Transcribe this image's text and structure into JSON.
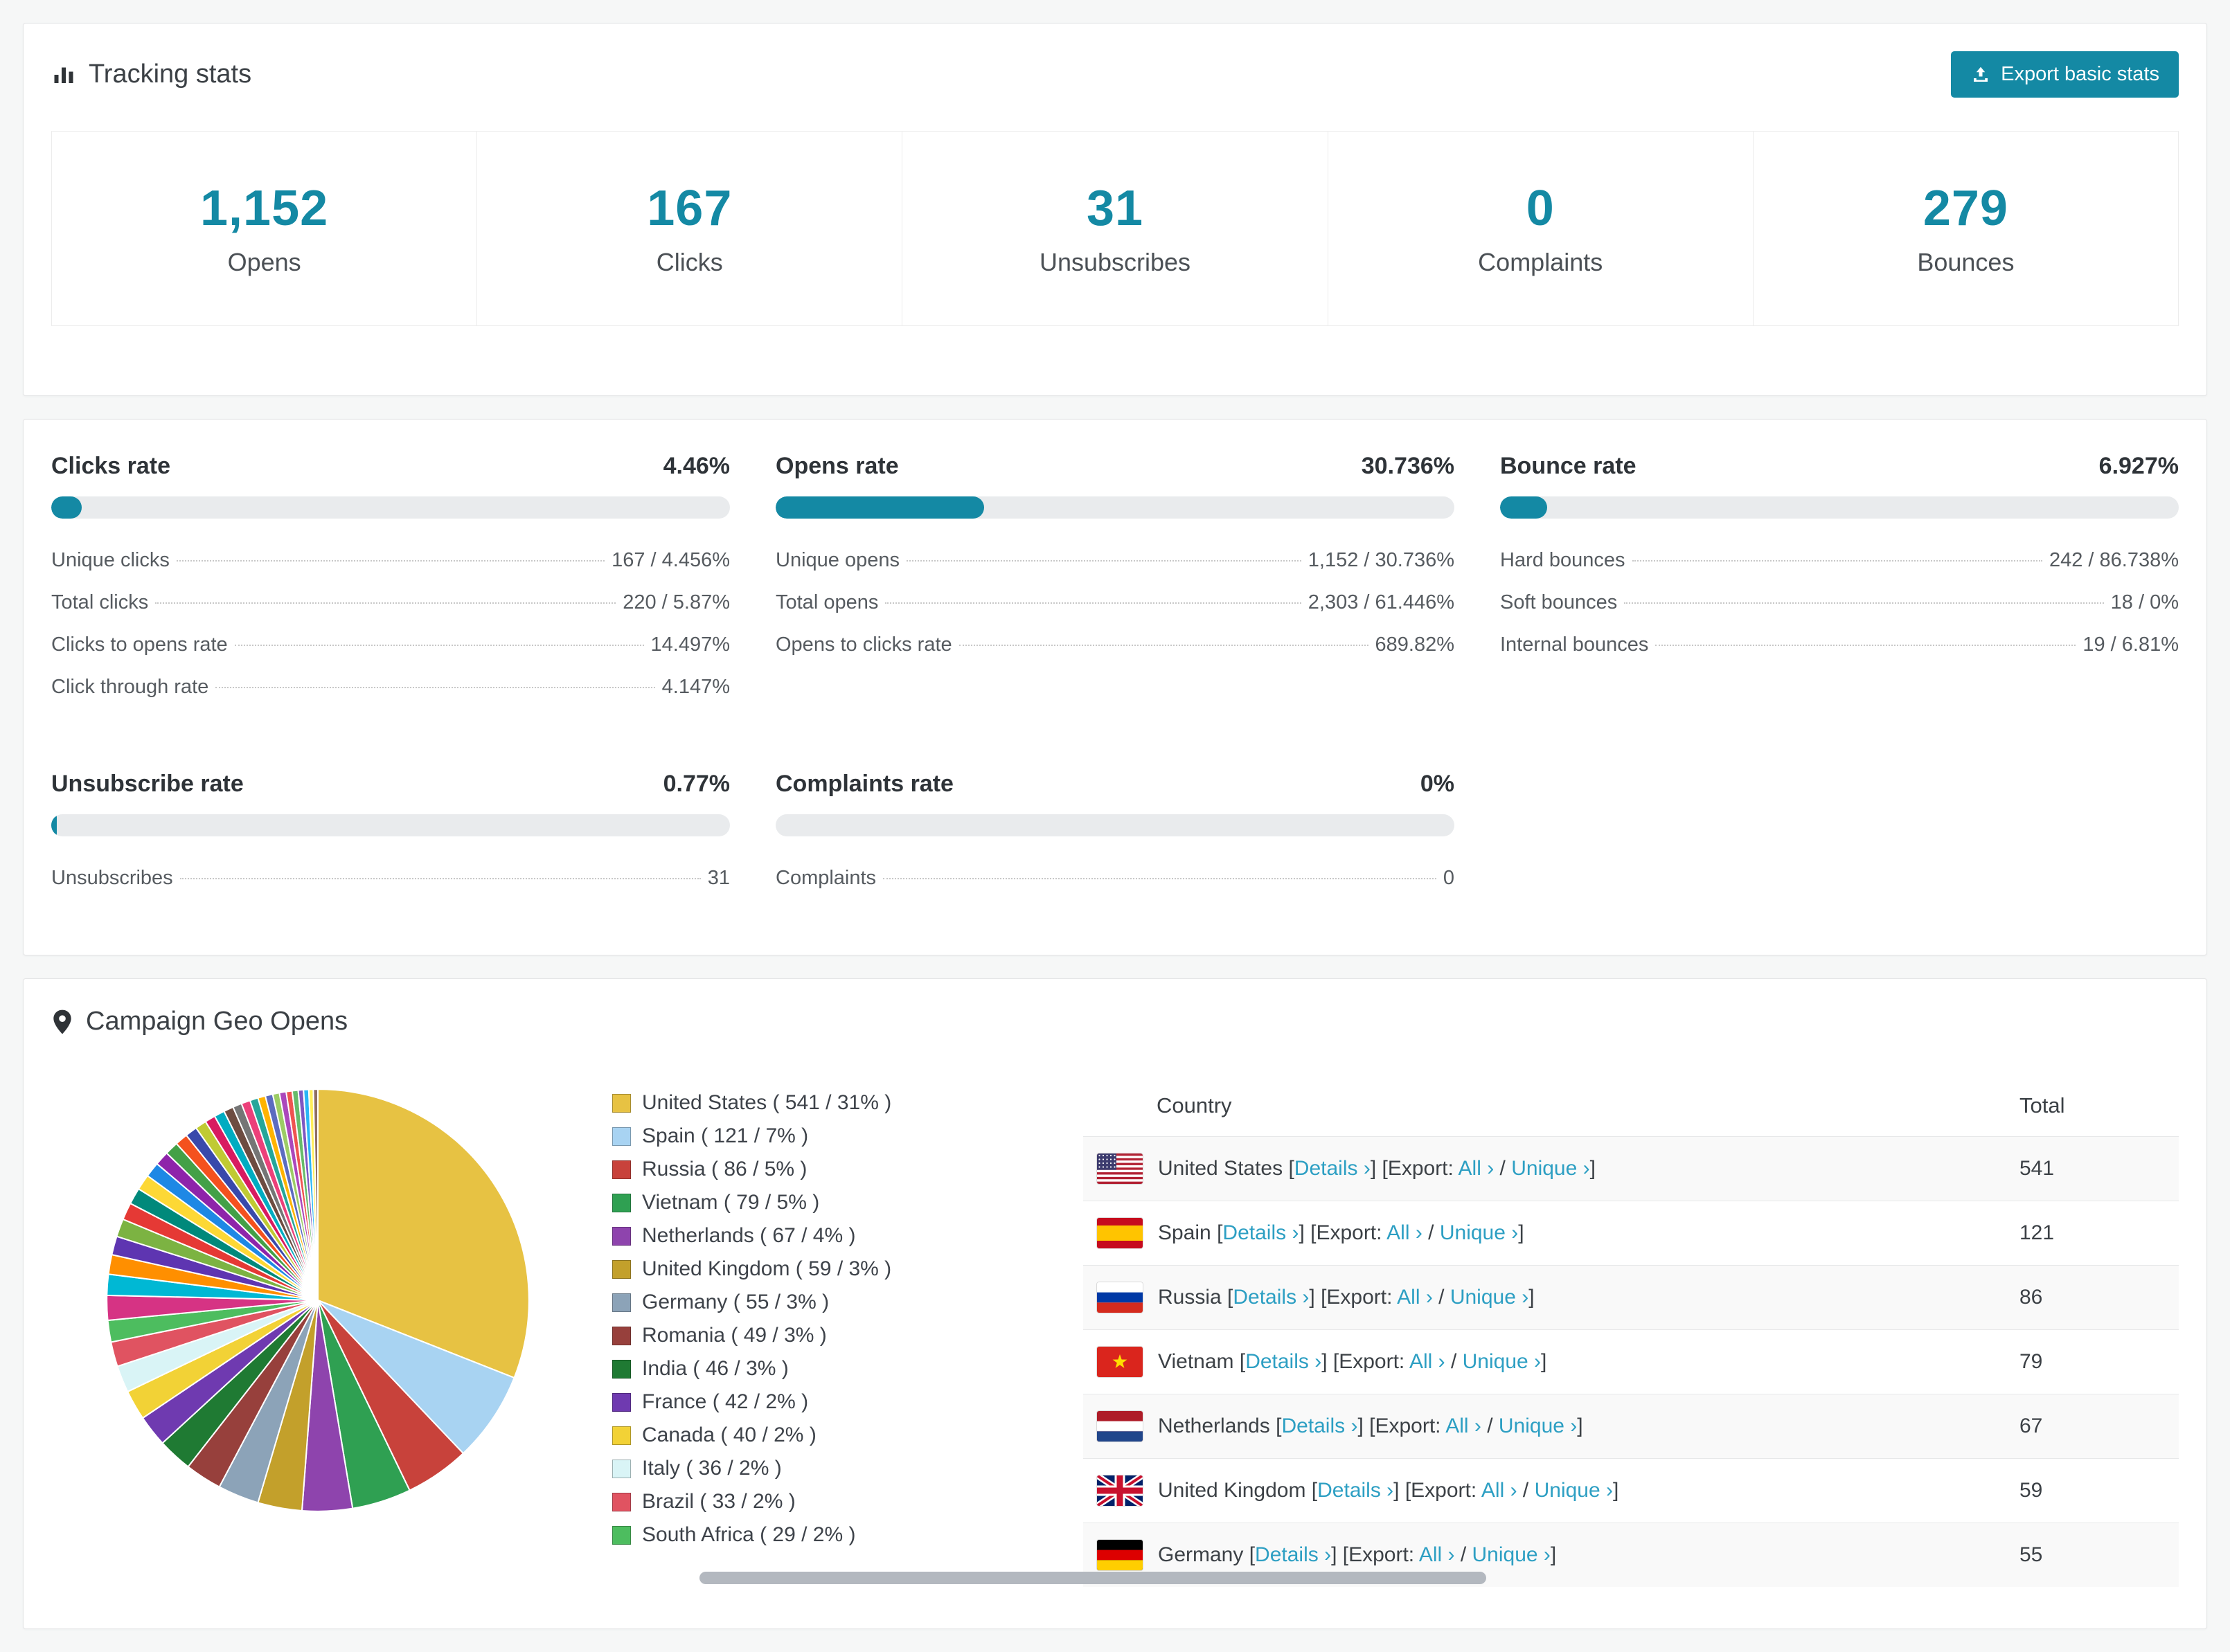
{
  "colors": {
    "accent": "#1489a4",
    "link": "#2d9fc3"
  },
  "tracking": {
    "title": "Tracking stats",
    "export_button": "Export basic stats",
    "stats": [
      {
        "value": "1,152",
        "label": "Opens"
      },
      {
        "value": "167",
        "label": "Clicks"
      },
      {
        "value": "31",
        "label": "Unsubscribes"
      },
      {
        "value": "0",
        "label": "Complaints"
      },
      {
        "value": "279",
        "label": "Bounces"
      }
    ]
  },
  "rates": [
    {
      "title": "Clicks rate",
      "value": "4.46%",
      "percent": 4.46,
      "rows": [
        {
          "label": "Unique clicks",
          "value": "167 / 4.456%"
        },
        {
          "label": "Total clicks",
          "value": "220 / 5.87%"
        },
        {
          "label": "Clicks to opens rate",
          "value": "14.497%"
        },
        {
          "label": "Click through rate",
          "value": "4.147%"
        }
      ]
    },
    {
      "title": "Opens rate",
      "value": "30.736%",
      "percent": 30.736,
      "rows": [
        {
          "label": "Unique opens",
          "value": "1,152 / 30.736%"
        },
        {
          "label": "Total opens",
          "value": "2,303 / 61.446%"
        },
        {
          "label": "Opens to clicks rate",
          "value": "689.82%"
        }
      ]
    },
    {
      "title": "Bounce rate",
      "value": "6.927%",
      "percent": 6.927,
      "rows": [
        {
          "label": "Hard bounces",
          "value": "242 / 86.738%"
        },
        {
          "label": "Soft bounces",
          "value": "18 / 0%"
        },
        {
          "label": "Internal bounces",
          "value": "19 / 6.81%"
        }
      ]
    },
    {
      "title": "Unsubscribe rate",
      "value": "0.77%",
      "percent": 0.77,
      "rows": [
        {
          "label": "Unsubscribes",
          "value": "31"
        }
      ]
    },
    {
      "title": "Complaints rate",
      "value": "0%",
      "percent": 0,
      "rows": [
        {
          "label": "Complaints",
          "value": "0"
        }
      ]
    }
  ],
  "geo": {
    "title": "Campaign Geo Opens",
    "table": {
      "headers": [
        "Country",
        "Total"
      ],
      "link_labels": {
        "details": "Details",
        "export": "Export:",
        "all": "All",
        "unique": "Unique",
        "arrow": "›"
      },
      "punctuation": {
        "open": "[",
        "close": "]",
        "slash": "/"
      },
      "rows": [
        {
          "flag": "us",
          "country": "United States",
          "total": "541"
        },
        {
          "flag": "es",
          "country": "Spain",
          "total": "121"
        },
        {
          "flag": "ru",
          "country": "Russia",
          "total": "86"
        },
        {
          "flag": "vn",
          "country": "Vietnam",
          "total": "79"
        },
        {
          "flag": "nl",
          "country": "Netherlands",
          "total": "67"
        },
        {
          "flag": "gb",
          "country": "United Kingdom",
          "total": "59"
        },
        {
          "flag": "de",
          "country": "Germany",
          "total": "55"
        }
      ]
    }
  },
  "chart_data": {
    "type": "pie",
    "title": "Campaign Geo Opens",
    "legend_position": "right",
    "labels": [
      "United States",
      "Spain",
      "Russia",
      "Vietnam",
      "Netherlands",
      "United Kingdom",
      "Germany",
      "Romania",
      "India",
      "France",
      "Canada",
      "Italy",
      "Brazil",
      "South Africa"
    ],
    "values": [
      541,
      121,
      86,
      79,
      67,
      59,
      55,
      49,
      46,
      42,
      40,
      36,
      33,
      29
    ],
    "percents": [
      31,
      7,
      5,
      5,
      4,
      3,
      3,
      3,
      3,
      2,
      2,
      2,
      2,
      2
    ],
    "colors": [
      "#e7c243",
      "#a8d3f2",
      "#c8423b",
      "#2fa052",
      "#8e44ad",
      "#c3a02b",
      "#8ca3b8",
      "#97403c",
      "#1f7a33",
      "#6f3ab0",
      "#f2d236",
      "#d9f4f6",
      "#e05361",
      "#4dbd5f"
    ],
    "others": [
      {
        "value": 33,
        "color": "#d63384"
      },
      {
        "value": 28,
        "color": "#00b8d4"
      },
      {
        "value": 26,
        "color": "#ff8f00"
      },
      {
        "value": 25,
        "color": "#5e35b1"
      },
      {
        "value": 24,
        "color": "#7cb342"
      },
      {
        "value": 23,
        "color": "#e53935"
      },
      {
        "value": 22,
        "color": "#00897b"
      },
      {
        "value": 21,
        "color": "#fdd835"
      },
      {
        "value": 20,
        "color": "#1e88e5"
      },
      {
        "value": 19,
        "color": "#8e24aa"
      },
      {
        "value": 18,
        "color": "#43a047"
      },
      {
        "value": 17,
        "color": "#f4511e"
      },
      {
        "value": 16,
        "color": "#3949ab"
      },
      {
        "value": 15,
        "color": "#c0ca33"
      },
      {
        "value": 14,
        "color": "#d81b60"
      },
      {
        "value": 14,
        "color": "#00acc1"
      },
      {
        "value": 13,
        "color": "#6d4c41"
      },
      {
        "value": 12,
        "color": "#757575"
      },
      {
        "value": 12,
        "color": "#ec407a"
      },
      {
        "value": 11,
        "color": "#26a69a"
      },
      {
        "value": 10,
        "color": "#ffb300"
      },
      {
        "value": 10,
        "color": "#5c6bc0"
      },
      {
        "value": 9,
        "color": "#9ccc65"
      },
      {
        "value": 9,
        "color": "#ab47bc"
      },
      {
        "value": 8,
        "color": "#ef5350"
      },
      {
        "value": 8,
        "color": "#66bb6a"
      },
      {
        "value": 7,
        "color": "#7e57c2"
      },
      {
        "value": 7,
        "color": "#29b6f6"
      },
      {
        "value": 6,
        "color": "#ffee58"
      },
      {
        "value": 6,
        "color": "#8d6e63"
      }
    ]
  }
}
